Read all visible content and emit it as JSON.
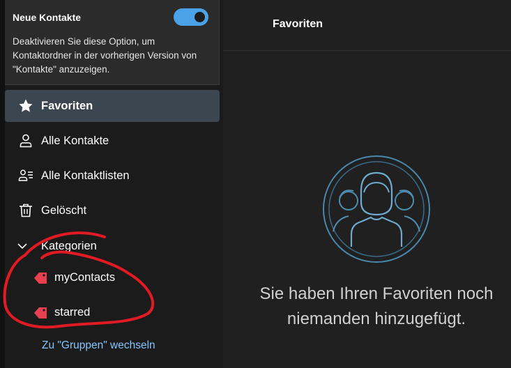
{
  "toggle_card": {
    "title": "Neue Kontakte",
    "enabled": true,
    "description": "Deaktivieren Sie diese Option, um Kontaktordner in der vorherigen Version von \"Kontakte\" anzuzeigen."
  },
  "nav": {
    "items": [
      {
        "label": "Favoriten",
        "icon": "star-icon",
        "active": true
      },
      {
        "label": "Alle Kontakte",
        "icon": "person-icon",
        "active": false
      },
      {
        "label": "Alle Kontaktlisten",
        "icon": "contact-list-icon",
        "active": false
      },
      {
        "label": "Gelöscht",
        "icon": "trash-icon",
        "active": false
      }
    ]
  },
  "categories": {
    "header": "Kategorien",
    "items": [
      {
        "label": "myContacts",
        "icon": "tag-icon"
      },
      {
        "label": "starred",
        "icon": "tag-icon"
      }
    ]
  },
  "switch_link": "Zu \"Gruppen\" wechseln",
  "main": {
    "title": "Favoriten",
    "empty_message": "Sie haben Ihren Favoriten noch niemanden hinzugefügt."
  },
  "colors": {
    "accent": "#4ca2e6",
    "link": "#85c6ff",
    "tag": "#e8404f",
    "annotation": "#e01b24"
  }
}
